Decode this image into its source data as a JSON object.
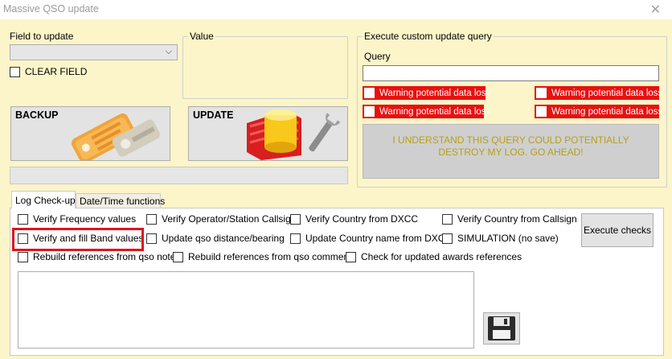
{
  "window": {
    "title": "Massive QSO update",
    "close_icon": "close-icon"
  },
  "field_update": {
    "label": "Field to update",
    "selected": "",
    "clear_field_label": "CLEAR FIELD",
    "clear_field_checked": false
  },
  "value_group": {
    "title": "Value"
  },
  "custom_query": {
    "title": "Execute custom update query",
    "query_label": "Query",
    "query_value": "",
    "warnings": [
      {
        "label": "Warning potential data loss",
        "checked": false
      },
      {
        "label": "Warning potential data loss",
        "checked": false
      },
      {
        "label": "Warning potential data loss",
        "checked": false
      },
      {
        "label": "Warning potential data loss",
        "checked": false
      }
    ],
    "go_ahead_label": "I UNDERSTAND THIS QUERY COULD POTENTIALLY DESTROY MY LOG. GO AHEAD!"
  },
  "buttons": {
    "backup_label": "BACKUP",
    "backup_icon": "keys-icon",
    "update_label": "UPDATE",
    "update_icon": "database-wrench-icon",
    "execute_checks_label": "Execute checks",
    "save_icon": "floppy-disk-icon"
  },
  "tabs": [
    {
      "label": "Log Check-up",
      "active": true
    },
    {
      "label": "Date/Time functions",
      "active": false
    }
  ],
  "checks": {
    "verify_frequency": "Verify Frequency values",
    "verify_operator": "Verify Operator/Station Callsign",
    "verify_country_dxcc": "Verify Country from DXCC",
    "verify_country_callsign": "Verify Country from Callsign",
    "verify_band": "Verify and fill Band values",
    "update_distance": "Update qso distance/bearing",
    "update_country_name": "Update Country name from DXCC",
    "simulation": "SIMULATION (no save)",
    "rebuild_notes": "Rebuild references from qso notes",
    "rebuild_comments": "Rebuild references from qso comments",
    "check_awards": "Check for updated awards references"
  },
  "colors": {
    "window_bg": "#fbf5c9",
    "warning_red": "#e81010",
    "go_ahead_text": "#b6a018",
    "highlight_red": "#e0141e"
  }
}
